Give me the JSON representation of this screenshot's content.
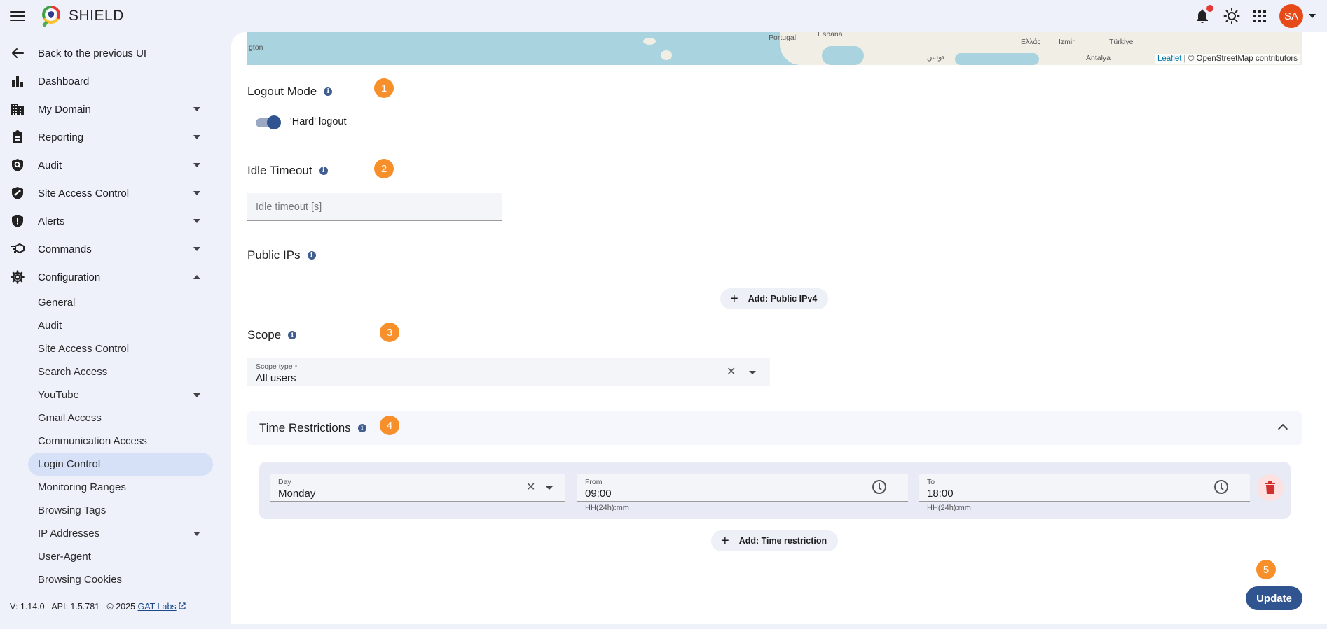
{
  "app": {
    "title": "SHIELD"
  },
  "header": {
    "avatar_initials": "SA"
  },
  "sidebar": {
    "back": "Back to the previous UI",
    "items": [
      {
        "label": "Dashboard",
        "icon": "bar-chart-icon"
      },
      {
        "label": "My Domain",
        "icon": "building-icon"
      },
      {
        "label": "Reporting",
        "icon": "clipboard-icon"
      },
      {
        "label": "Audit",
        "icon": "search-shield-icon"
      },
      {
        "label": "Site Access Control",
        "icon": "shield-link-icon"
      },
      {
        "label": "Alerts",
        "icon": "alert-shield-icon"
      },
      {
        "label": "Commands",
        "icon": "commands-icon"
      },
      {
        "label": "Configuration",
        "icon": "gear-icon"
      }
    ],
    "config_children": [
      "General",
      "Audit",
      "Site Access Control",
      "Search Access",
      "YouTube",
      "Gmail Access",
      "Communication Access",
      "Login Control",
      "Monitoring Ranges",
      "Browsing Tags",
      "IP Addresses",
      "User-Agent",
      "Browsing Cookies"
    ],
    "footer": {
      "version": "V: 1.14.0",
      "api": "API: 1.5.781",
      "copyright": "© 2025",
      "company": "GAT Labs"
    }
  },
  "map": {
    "labels": [
      "gton",
      "Portugal",
      "España",
      "Ελλάς",
      "İzmir",
      "Türkiye",
      "Antalya",
      "تونس"
    ],
    "attribution_leaflet": "Leaflet",
    "attribution_rest": "| © OpenStreetMap contributors"
  },
  "form": {
    "logout_mode": {
      "title": "Logout Mode",
      "badge": "1",
      "toggle_label": "'Hard' logout",
      "toggle_on": true
    },
    "idle_timeout": {
      "title": "Idle Timeout",
      "badge": "2",
      "placeholder": "Idle timeout [s]"
    },
    "public_ips": {
      "title": "Public IPs",
      "add_label": "Add: Public IPv4"
    },
    "scope": {
      "title": "Scope",
      "badge": "3",
      "field_label": "Scope type *",
      "value": "All users"
    },
    "time_restrictions": {
      "title": "Time Restrictions",
      "badge": "4",
      "rows": [
        {
          "day_label": "Day",
          "day": "Monday",
          "from_label": "From",
          "from": "09:00",
          "to_label": "To",
          "to": "18:00",
          "helper": "HH(24h):mm"
        }
      ],
      "add_label": "Add: Time restriction"
    },
    "update": {
      "badge": "5",
      "label": "Update"
    }
  },
  "colors": {
    "accent": "#2f5490",
    "badge": "#f7902a",
    "danger": "#d32f2f"
  }
}
